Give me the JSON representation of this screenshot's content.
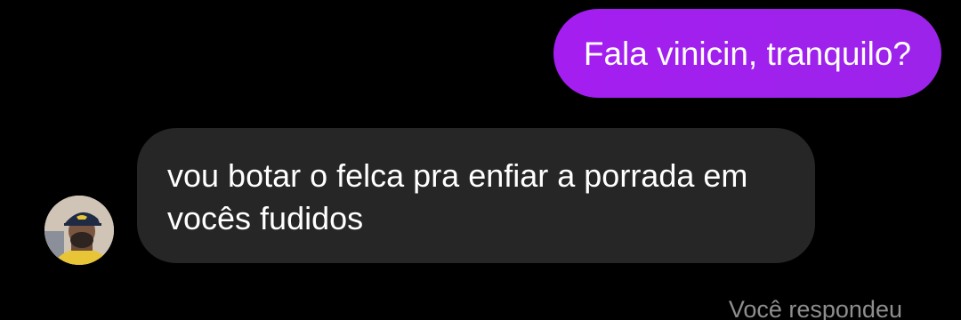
{
  "conversation": {
    "outgoing_message": "Fala vinicin, tranquilo?",
    "incoming_message": "vou botar o felca pra enfiar a porrada em vocês fudidos",
    "reply_note": "Você respondeu"
  },
  "colors": {
    "background": "#000000",
    "outgoing_bubble": "#a020f0",
    "incoming_bubble": "#262626",
    "text": "#ffffff",
    "muted_text": "#8e8e8e"
  },
  "icons": {
    "avatar": "profile-photo"
  }
}
